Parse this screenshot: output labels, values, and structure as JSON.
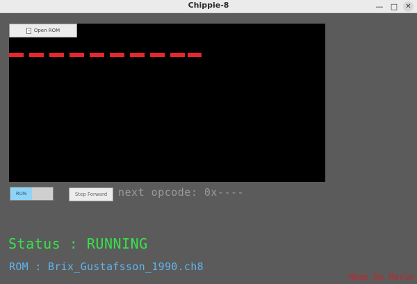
{
  "window": {
    "title": "Chippie-8",
    "minimize_glyph": "—",
    "maximize_glyph": "□",
    "close_glyph": "✕"
  },
  "toolbar": {
    "open_rom_label": "Open ROM",
    "open_rom_icon": "file-icon"
  },
  "display": {
    "background": "#000000",
    "pixel_color": "#e8262b"
  },
  "controls": {
    "run_toggle_label": "RUN",
    "run_toggle_on": true,
    "step_forward_label": "Step Forward",
    "next_opcode_text": "next opcode: 0x----"
  },
  "status": {
    "text": "Status : RUNNING",
    "color": "#37e24b"
  },
  "rom": {
    "text": "ROM : Brix_Gustafsson_1990.ch8",
    "color": "#5fb4ee"
  },
  "footer": {
    "credit_text": "Made By Marun",
    "credit_color": "#c1272d"
  }
}
